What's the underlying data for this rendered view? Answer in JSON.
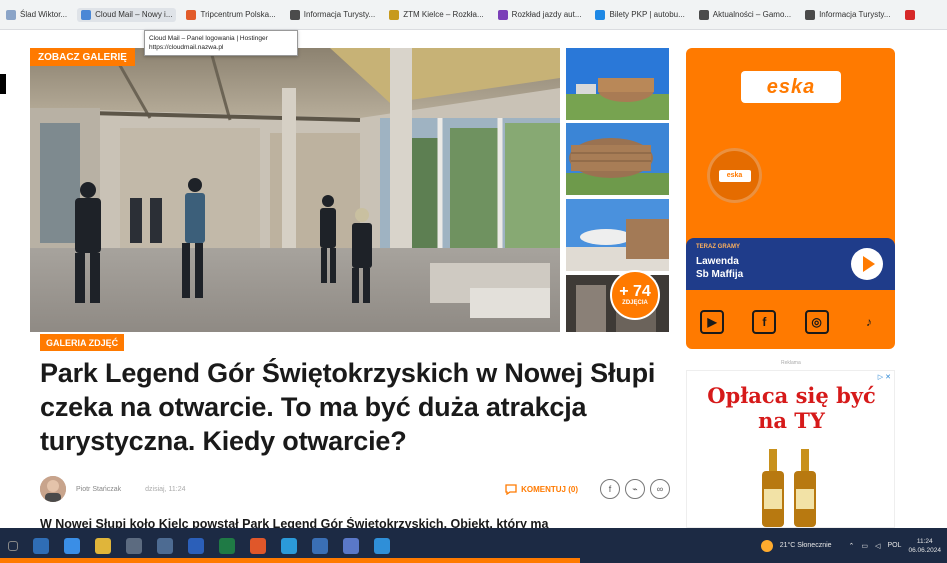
{
  "bookmarks": [
    {
      "label": "Ślad Wiktor...",
      "color": "#8aa4c8"
    },
    {
      "label": "Cloud Mail – Nowy i...",
      "color": "#4a87d6",
      "active": true
    },
    {
      "label": "Tripcentrum Polska...",
      "color": "#e25b2a"
    },
    {
      "label": "Informacja Turysty...",
      "color": "#4b4b4b"
    },
    {
      "label": "ZTM Kielce – Rozkła...",
      "color": "#c79a1d"
    },
    {
      "label": "Rozkład jazdy aut...",
      "color": "#7b3fb8"
    },
    {
      "label": "Bilety PKP | autobu...",
      "color": "#1e88e5"
    },
    {
      "label": "Aktualności – Gamo...",
      "color": "#4b4b4b"
    },
    {
      "label": "Informacja Turysty...",
      "color": "#4b4b4b"
    },
    {
      "label": "",
      "color": "#d62828"
    }
  ],
  "tooltip": {
    "line1": "Cloud Mail – Panel logowania | Hostinger",
    "line2": "https://cloudmail.nazwa.pl"
  },
  "gallery_tag": "ZOBACZ GALERIĘ",
  "more_photos": {
    "count": "+ 74",
    "label": "ZDJĘCIA"
  },
  "section_tag": "GALERIA ZDJĘĆ",
  "headline": "Park Legend Gór Świętokrzyskich w Nowej Słupi czeka na otwarcie. To ma być duża atrakcja turystyczna. Kiedy otwarcie?",
  "author": {
    "name": "Piotr Stańczak",
    "date": "dzisiaj, 11:24"
  },
  "comments_label": "KOMENTUJ (0)",
  "lead": "W Nowej Słupi koło Kielc powstał Park Legend Gór Świętokrzyskich. Obiekt, który ma",
  "eska": {
    "logo": "eska",
    "mini_logo": "eska",
    "now_label": "TERAZ GRAMY",
    "song": "Lawenda",
    "artist": "Sb Maffija"
  },
  "ad": {
    "label": "Reklama",
    "text_line1": "Opłaca się być",
    "text_line2": "na TY"
  },
  "tray": {
    "weather": "21°C Słonecznie",
    "lang": "POL",
    "time": "11:24",
    "date": "06.06.2024"
  },
  "colors": {
    "accent": "#ff7a00",
    "taskbar": "#1c2a44",
    "player": "#1f3c8a"
  }
}
